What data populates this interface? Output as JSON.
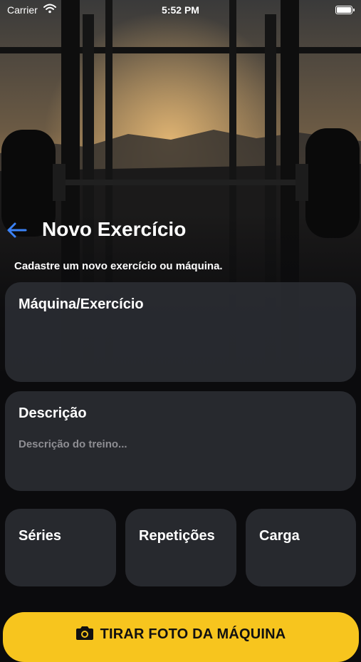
{
  "status_bar": {
    "carrier": "Carrier",
    "time": "5:52 PM"
  },
  "header": {
    "title": "Novo Exercício",
    "subtitle": "Cadastre um novo exercício ou máquina."
  },
  "form": {
    "machine": {
      "label": "Máquina/Exercício",
      "value": ""
    },
    "description": {
      "label": "Descrição",
      "placeholder": "Descrição do treino..."
    },
    "series": {
      "label": "Séries"
    },
    "reps": {
      "label": "Repetições"
    },
    "load": {
      "label": "Carga"
    }
  },
  "photo_button": {
    "label": "TIRAR FOTO DA MÁQUINA",
    "icon": "camera-icon"
  },
  "colors": {
    "accent": "#f7c51e",
    "back_arrow": "#3b82f6",
    "card_bg": "#2a2c32"
  }
}
